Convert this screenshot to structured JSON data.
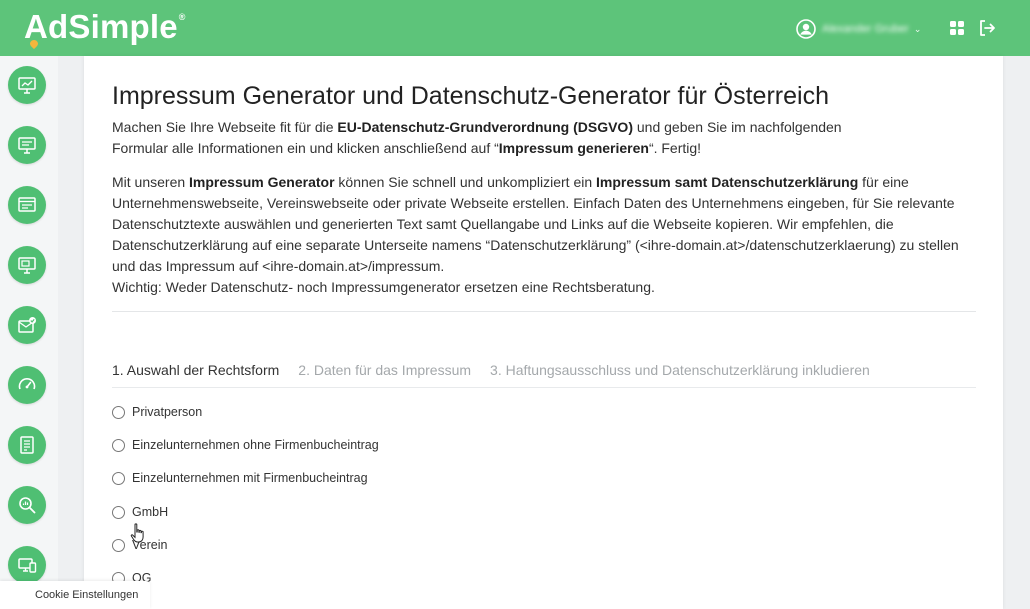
{
  "header": {
    "logo_text": "AdSimple",
    "logo_reg": "®",
    "user_name": "Alexander Gruber",
    "user_caret": "⌄",
    "accent_color": "#5dc47a"
  },
  "sidebar": {
    "items": [
      {
        "icon": "presentation-icon"
      },
      {
        "icon": "monitor-icon"
      },
      {
        "icon": "list-window-icon"
      },
      {
        "icon": "browser-icon"
      },
      {
        "icon": "mail-check-icon"
      },
      {
        "icon": "speedometer-icon"
      },
      {
        "icon": "document-icon"
      },
      {
        "icon": "search-analytics-icon"
      },
      {
        "icon": "devices-icon"
      }
    ]
  },
  "main": {
    "title": "Impressum Generator und Datenschutz-Generator für Österreich",
    "intro": {
      "t1": "Machen Sie Ihre Webseite fit für die ",
      "b1": "EU-Datenschutz-Grundverordnung (DSGVO)",
      "t2": " und geben Sie im nachfolgenden Formular alle Informationen ein und klicken anschließend auf “",
      "b2": "Impressum generieren",
      "t3": "“. Fertig!"
    },
    "description": {
      "t1": "Mit unseren ",
      "b1": "Impressum Generator",
      "t2": " können Sie schnell und unkompliziert ein ",
      "b2": "Impressum samt Datenschutzerklärung",
      "t3": " für eine Unternehmenswebseite, Vereinswebseite oder private Webseite erstellen. Einfach Daten des Unternehmens eingeben, für Sie relevante Datenschutztexte auswählen und generierten Text samt Quellangabe und Links auf die Webseite kopieren. Wir empfehlen, die Datenschutzerklärung auf eine separate Unterseite namens “Datenschutzerklärung” (<ihre-domain.at>/datenschutzerklaerung) zu stellen und das Impressum auf <ihre-domain.at>/impressum.",
      "t4": "Wichtig: Weder Datenschutz- noch Impressumgenerator ersetzen eine Rechtsberatung."
    },
    "steps": [
      {
        "label": "1. Auswahl der Rechtsform",
        "active": true
      },
      {
        "label": "2. Daten für das Impressum",
        "active": false
      },
      {
        "label": "3. Haftungsausschluss und Datenschutzerklärung inkludieren",
        "active": false
      }
    ],
    "legal_forms": [
      "Privatperson",
      "Einzelunternehmen ohne Firmenbucheintrag",
      "Einzelunternehmen mit Firmenbucheintrag",
      "GmbH",
      "Verein",
      "OG"
    ]
  },
  "footer": {
    "cookie_label": "Cookie Einstellungen"
  }
}
